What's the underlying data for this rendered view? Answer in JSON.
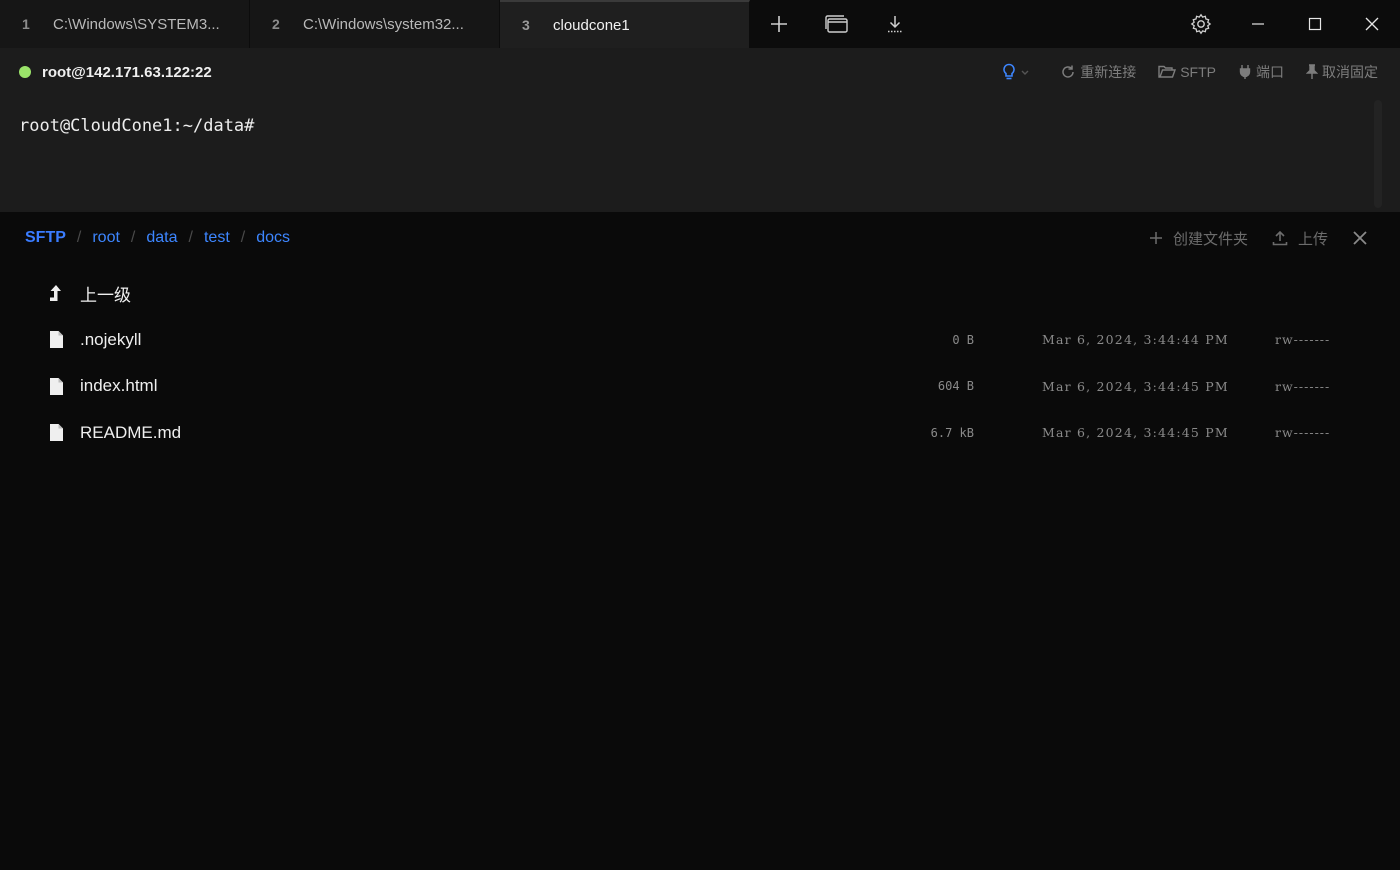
{
  "tabs": [
    {
      "number": "1",
      "label": "C:\\Windows\\SYSTEM3...",
      "active": false
    },
    {
      "number": "2",
      "label": "C:\\Windows\\system32...",
      "active": false
    },
    {
      "number": "3",
      "label": "cloudcone1",
      "active": true
    }
  ],
  "titlebar": {
    "icons": [
      "plus-icon",
      "window-icon",
      "download-icon",
      "gear-icon",
      "minimize-icon",
      "maximize-icon",
      "close-icon"
    ]
  },
  "connection": {
    "status_color": "#9be36a",
    "host": "root@142.171.63.122:22",
    "actions": {
      "reconnect": "重新连接",
      "sftp": "SFTP",
      "port": "端口",
      "unpin": "取消固定"
    }
  },
  "terminal": {
    "prompt": "root@CloudCone1:~/data#"
  },
  "sftp": {
    "breadcrumb": [
      "SFTP",
      "root",
      "data",
      "test",
      "docs"
    ],
    "create_folder": "创建文件夹",
    "upload": "上传",
    "parent_label": "上一级",
    "files": [
      {
        "name": ".nojekyll",
        "size": "0 B",
        "modified": "Mar 6, 2024, 3:44:44 PM",
        "perms": "rw-------"
      },
      {
        "name": "index.html",
        "size": "604 B",
        "modified": "Mar 6, 2024, 3:44:45 PM",
        "perms": "rw-------"
      },
      {
        "name": "README.md",
        "size": "6.7 kB",
        "modified": "Mar 6, 2024, 3:44:45 PM",
        "perms": "rw-------"
      }
    ]
  },
  "colors": {
    "accent": "#3d86ff",
    "background": "#0a0a0a",
    "panel": "#1c1c1c"
  }
}
